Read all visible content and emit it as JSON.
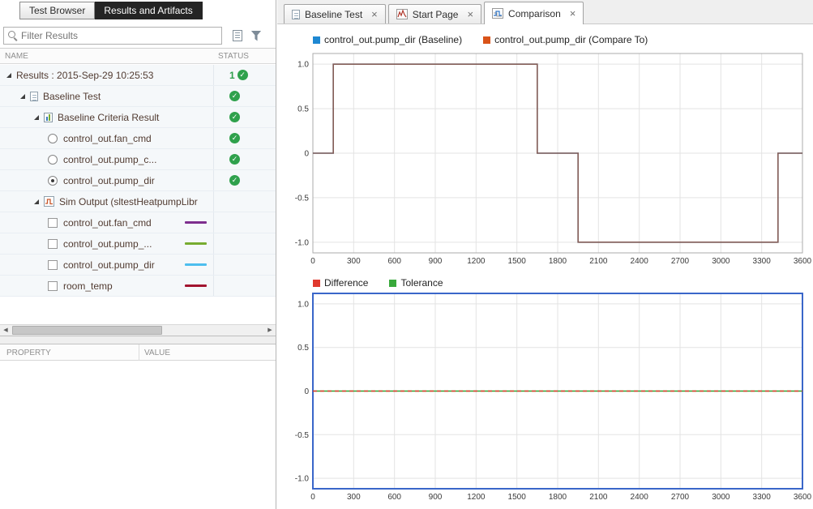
{
  "left_panel": {
    "tabs": [
      {
        "label": "Test Browser",
        "active": false
      },
      {
        "label": "Results and Artifacts",
        "active": true
      }
    ],
    "filter": {
      "placeholder": "Filter Results"
    },
    "tree": {
      "columns": [
        "NAME",
        "STATUS"
      ],
      "rows": [
        {
          "label": "Results : 2015-Sep-29 10:25:53",
          "indent": 0,
          "expander": true,
          "icon": null,
          "control": null,
          "status_count": "1",
          "status_pass": true
        },
        {
          "label": "Baseline Test",
          "indent": 1,
          "expander": true,
          "icon": "document",
          "control": null,
          "status_pass": true
        },
        {
          "label": "Baseline Criteria Result",
          "indent": 2,
          "expander": true,
          "icon": "criteria-chart",
          "control": null,
          "status_pass": true
        },
        {
          "label": "control_out.fan_cmd",
          "indent": 3,
          "expander": false,
          "icon": null,
          "control": "radio",
          "selected": false,
          "status_pass": true
        },
        {
          "label": "control_out.pump_c...",
          "indent": 3,
          "expander": false,
          "icon": null,
          "control": "radio",
          "selected": false,
          "status_pass": true
        },
        {
          "label": "control_out.pump_dir",
          "indent": 3,
          "expander": false,
          "icon": null,
          "control": "radio",
          "selected": true,
          "status_pass": true
        },
        {
          "label": "Sim Output (sltestHeatpumpLibr",
          "indent": 2,
          "expander": true,
          "icon": "signal",
          "control": null,
          "status_pass": false
        },
        {
          "label": "control_out.fan_cmd",
          "indent": 3,
          "expander": false,
          "icon": null,
          "control": "checkbox",
          "checked": false,
          "swatch": "#7E2F8E",
          "status_pass": false
        },
        {
          "label": "control_out.pump_...",
          "indent": 3,
          "expander": false,
          "icon": null,
          "control": "checkbox",
          "checked": false,
          "swatch": "#77AC30",
          "status_pass": false
        },
        {
          "label": "control_out.pump_dir",
          "indent": 3,
          "expander": false,
          "icon": null,
          "control": "checkbox",
          "checked": false,
          "swatch": "#4DBEEE",
          "status_pass": false
        },
        {
          "label": "room_temp",
          "indent": 3,
          "expander": false,
          "icon": null,
          "control": "checkbox",
          "checked": false,
          "swatch": "#A2142F",
          "status_pass": false
        }
      ]
    },
    "property_panel": {
      "columns": [
        "PROPERTY",
        "VALUE"
      ]
    }
  },
  "document_area": {
    "tabs": [
      {
        "label": "Baseline Test",
        "icon": "document-icon",
        "active": false
      },
      {
        "label": "Start Page",
        "icon": "start-page-icon",
        "active": false
      },
      {
        "label": "Comparison",
        "icon": "comparison-icon",
        "active": true
      }
    ]
  },
  "chart_data": [
    {
      "type": "line",
      "title": "",
      "legend": [
        {
          "label": "control_out.pump_dir (Baseline)",
          "color": "#1E88D2"
        },
        {
          "label": "control_out.pump_dir (Compare To)",
          "color": "#D95319"
        }
      ],
      "xlim": [
        0,
        3600
      ],
      "ylim": [
        -1.12,
        1.12
      ],
      "x_ticks": [
        0,
        300,
        600,
        900,
        1200,
        1500,
        1800,
        2100,
        2400,
        2700,
        3000,
        3300,
        3600
      ],
      "y_ticks": [
        1,
        0.5,
        0,
        -0.5,
        -1
      ],
      "y_tick_labels": [
        "1.0",
        "0.5",
        "0",
        "-0.5",
        "-1.0"
      ],
      "grid": true,
      "series": [
        {
          "name": "control_out.pump_dir (Baseline)",
          "color": "#0072BD",
          "x": [
            0,
            150,
            150,
            1650,
            1650,
            1950,
            1950,
            3420,
            3420,
            3600
          ],
          "y": [
            0,
            0,
            1,
            1,
            0,
            0,
            -1,
            -1,
            0,
            0
          ]
        },
        {
          "name": "control_out.pump_dir (Compare To)",
          "color": "#D95319",
          "opacity": 0.62,
          "x": [
            0,
            150,
            150,
            1650,
            1650,
            1950,
            1950,
            3420,
            3420,
            3600
          ],
          "y": [
            0,
            0,
            1,
            1,
            0,
            0,
            -1,
            -1,
            0,
            0
          ]
        }
      ]
    },
    {
      "type": "line",
      "title": "",
      "legend": [
        {
          "label": "Difference",
          "color": "#E0392E"
        },
        {
          "label": "Tolerance",
          "color": "#39A93B"
        }
      ],
      "xlim": [
        0,
        3600
      ],
      "ylim": [
        -1.12,
        1.12
      ],
      "x_ticks": [
        0,
        300,
        600,
        900,
        1200,
        1500,
        1800,
        2100,
        2400,
        2700,
        3000,
        3300,
        3600
      ],
      "y_ticks": [
        1,
        0.5,
        0,
        -0.5,
        -1
      ],
      "y_tick_labels": [
        "1.0",
        "0.5",
        "0",
        "-0.5",
        "-1.0"
      ],
      "grid": true,
      "border_color": "#3A66C9",
      "series": [
        {
          "name": "Tolerance",
          "color": "#2FA12F",
          "x": [
            0,
            3600
          ],
          "y": [
            0,
            0
          ]
        },
        {
          "name": "Difference",
          "color": "#E0392E",
          "dash": "5,4",
          "x": [
            0,
            3600
          ],
          "y": [
            0,
            0
          ]
        }
      ]
    }
  ]
}
